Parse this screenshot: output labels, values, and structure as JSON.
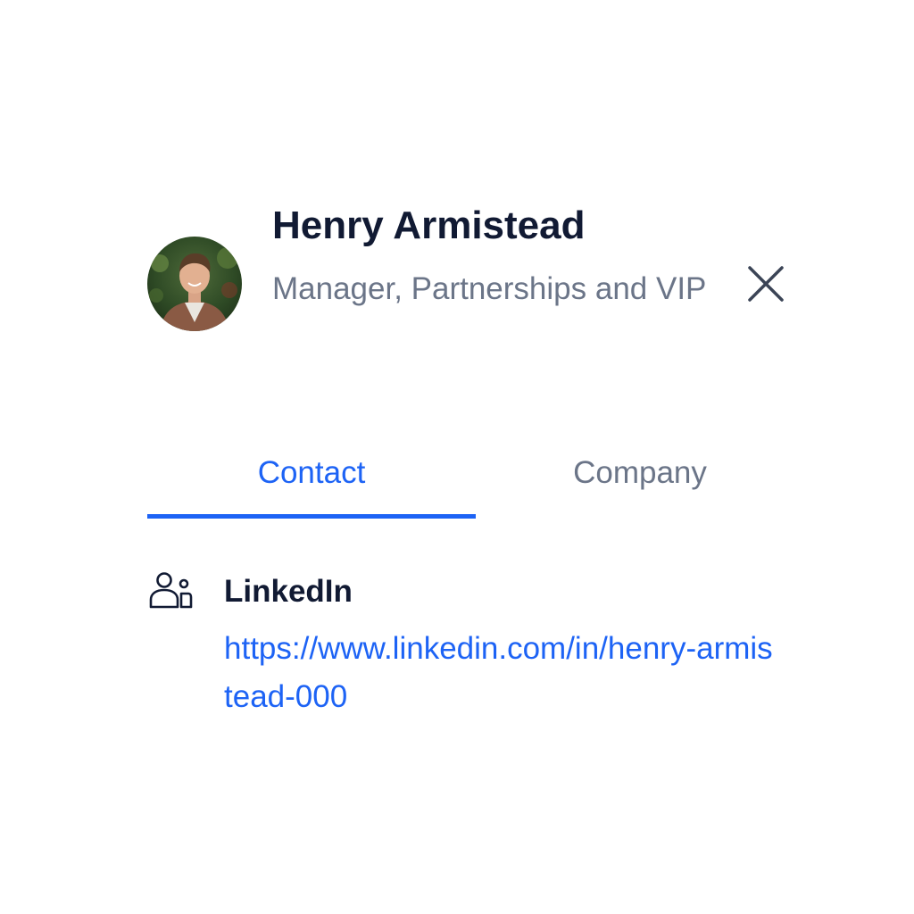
{
  "profile": {
    "name": "Henry Armistead",
    "title": "Manager, Partnerships and VIP"
  },
  "tabs": [
    {
      "label": "Contact",
      "active": true
    },
    {
      "label": "Company",
      "active": false
    }
  ],
  "contact": {
    "linkedin": {
      "label": "LinkedIn",
      "url": "https://www.linkedin.com/in/henry-armistead-000"
    }
  },
  "icons": {
    "close": "close-icon",
    "linkedin": "person-badge-icon"
  },
  "colors": {
    "accent": "#1d63f5",
    "heading": "#111a33",
    "muted": "#6b7588"
  }
}
